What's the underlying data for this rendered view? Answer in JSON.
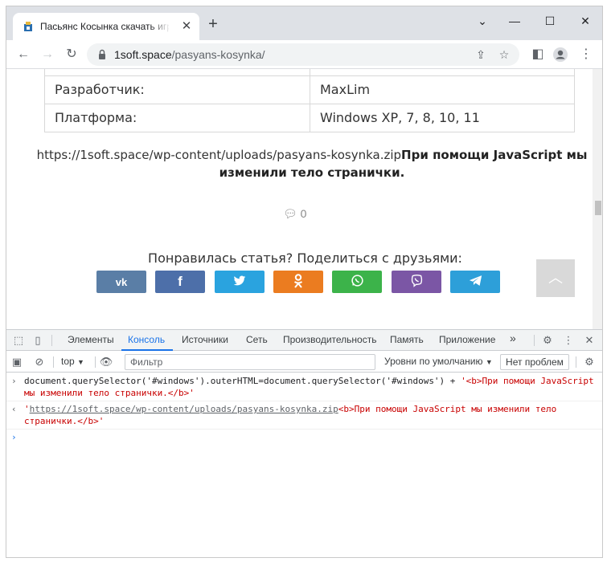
{
  "browser": {
    "tab_title": "Пасьянс Косынка скачать игру",
    "tab_close": "✕",
    "new_tab": "+",
    "url_host": "1soft.space",
    "url_path": "/pasyans-kosynka/"
  },
  "page": {
    "table": [
      {
        "label": "Разработчик:",
        "value": "MaxLim"
      },
      {
        "label": "Платформа:",
        "value": "Windows XP, 7, 8, 10, 11"
      }
    ],
    "link_text": "https://1soft.space/wp-content/uploads/pasyans-kosynka.zip",
    "injected_bold": "При помощи JavaScript мы изменили тело странички.",
    "comment_count": "0",
    "share_title": "Понравилась статья? Поделиться с друзьями:",
    "share_buttons": [
      {
        "icon": "vk-icon",
        "glyph": "vk",
        "color": "#5a7ea6"
      },
      {
        "icon": "facebook-icon",
        "glyph": "f",
        "color": "#4d6fa9"
      },
      {
        "icon": "twitter-icon",
        "glyph": "🐦",
        "color": "#2aa3df"
      },
      {
        "icon": "odnoklassniki-icon",
        "glyph": "ok",
        "color": "#eb7c20"
      },
      {
        "icon": "whatsapp-icon",
        "glyph": "✆",
        "color": "#3cb34a"
      },
      {
        "icon": "viber-icon",
        "glyph": "✆",
        "color": "#7b56a5"
      },
      {
        "icon": "telegram-icon",
        "glyph": "➤",
        "color": "#2d9fd9"
      }
    ]
  },
  "devtools": {
    "tabs": [
      "Элементы",
      "Консоль",
      "Источники",
      "Сеть",
      "Производительность",
      "Память",
      "Приложение"
    ],
    "more": "»",
    "context": "top",
    "filter_placeholder": "Фильтр",
    "levels": "Уровни по умолчанию",
    "issues": "Нет проблем",
    "console": {
      "input_code": "document.querySelector('#windows').outerHTML=document.querySelector('#windows') + ",
      "input_string": "'<b>При помощи JavaScript мы изменили тело странички.</b>'",
      "output_link": "https://1soft.space/wp-content/uploads/pasyans-kosynka.zip",
      "output_rest": "<b>При помощи JavaScript мы изменили тело странички.</b>'"
    }
  }
}
